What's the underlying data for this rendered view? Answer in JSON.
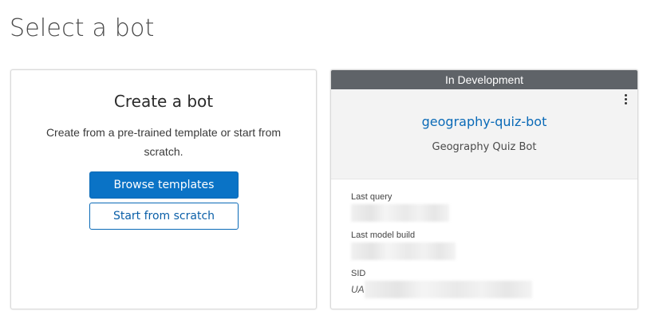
{
  "page": {
    "title": "Select a bot"
  },
  "create_card": {
    "title": "Create a bot",
    "description": "Create from a pre-trained template or start from scratch.",
    "browse_button": "Browse templates",
    "scratch_button": "Start from scratch"
  },
  "bot_card": {
    "status": "In Development",
    "name": "geography-quiz-bot",
    "display_name": "Geography Quiz Bot",
    "last_query_label": "Last query",
    "last_model_build_label": "Last model build",
    "sid_label": "SID",
    "sid_prefix": "UA"
  },
  "colors": {
    "primary": "#0a73c6",
    "status_bar": "#5f6368",
    "link": "#0a6ab7"
  },
  "icons": {
    "menu": "kebab-menu-icon"
  }
}
